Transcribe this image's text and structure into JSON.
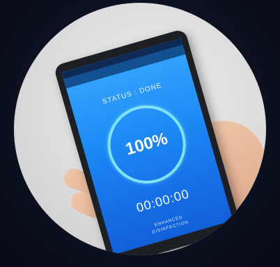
{
  "screen": {
    "status_label": "STATUS : DONE",
    "progress_percent": "100%",
    "progress_value": 1.0,
    "timer": "00:00:00",
    "mode_line1": "ENHANCED",
    "mode_line2": "DISINFECTION"
  },
  "colors": {
    "screen_top": "#37a8ff",
    "screen_bottom": "#1260d8",
    "ring": "#7ee3f5",
    "background": "#0c1120"
  },
  "icons": [
    "progress-ring"
  ]
}
